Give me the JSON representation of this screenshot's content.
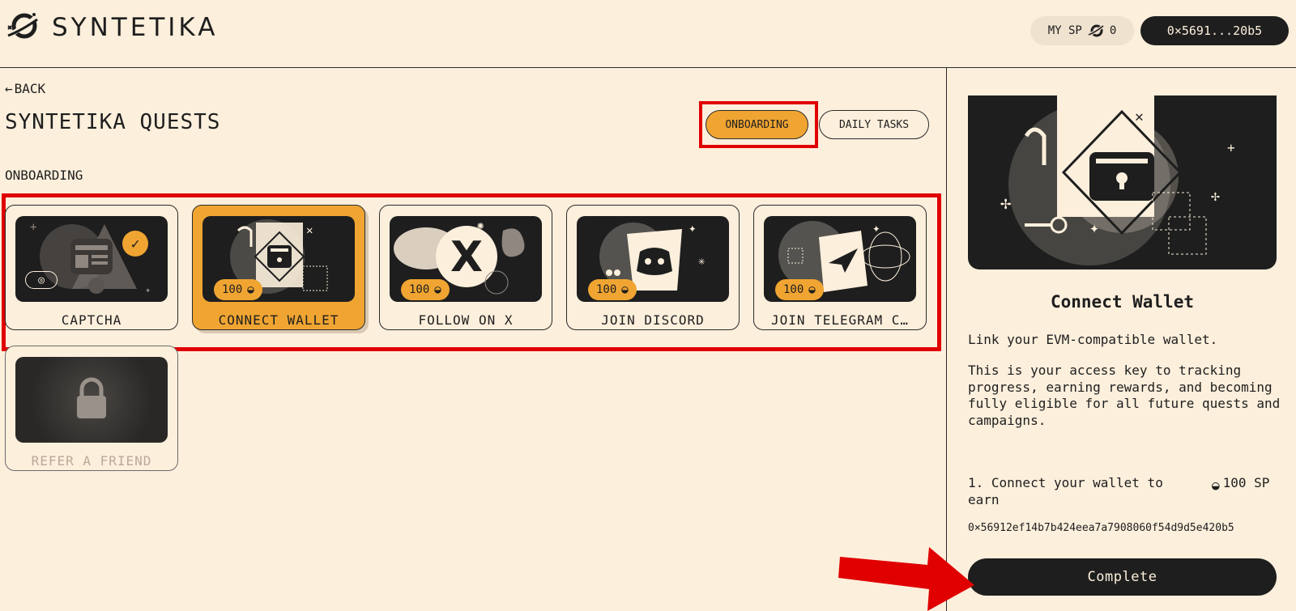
{
  "header": {
    "logo_text": "SYNTETIKA",
    "sp_label": "MY SP",
    "sp_value": "0",
    "wallet_short": "0×5691...20b5"
  },
  "nav": {
    "back_label": "BACK"
  },
  "page": {
    "title": "SYNTETIKA QUESTS"
  },
  "tabs": [
    {
      "label": "ONBOARDING",
      "active": true
    },
    {
      "label": "DAILY TASKS",
      "active": false
    }
  ],
  "section": {
    "label": "ONBOARDING"
  },
  "cards": [
    {
      "label": "CAPTCHA",
      "state": "completed"
    },
    {
      "label": "CONNECT WALLET",
      "reward": "100",
      "state": "selected"
    },
    {
      "label": "FOLLOW ON X",
      "reward": "100",
      "state": "available"
    },
    {
      "label": "JOIN DISCORD",
      "reward": "100",
      "state": "available"
    },
    {
      "label": "JOIN TELEGRAM C…",
      "reward": "100",
      "state": "available"
    },
    {
      "label": "REFER A FRIEND",
      "state": "locked"
    }
  ],
  "panel": {
    "title": "Connect Wallet",
    "description": "Link your EVM-compatible wallet.",
    "body": "This is your access key to tracking progress, earning rewards, and becoming fully eligible for all future quests and campaigns.",
    "step": "1. Connect your wallet to earn",
    "step_reward": "100 SP",
    "address": "0×56912ef14b7b424eea7a7908060f54d9d5e420b5",
    "complete_label": "Complete"
  },
  "colors": {
    "background": "#fcefdc",
    "accent": "#f0a532",
    "dark": "#1e1e1e",
    "annotation": "#e00000"
  }
}
